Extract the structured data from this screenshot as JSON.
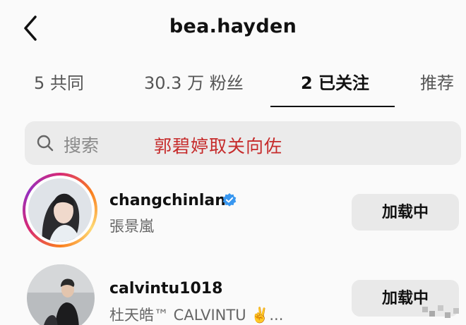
{
  "header": {
    "title": "bea.hayden",
    "back_icon": "chevron-left-icon"
  },
  "tabs": [
    {
      "label": "5 共同",
      "active": false
    },
    {
      "label": "30.3 万 粉丝",
      "active": false
    },
    {
      "label": "2 已关注",
      "active": true
    },
    {
      "label": "推荐",
      "active": false
    }
  ],
  "search": {
    "placeholder": "搜索",
    "overlay_caption": "郭碧婷取关向佐",
    "icon": "search-icon"
  },
  "list": [
    {
      "username": "changchinlan",
      "verified": true,
      "full_name": "張景嵐",
      "button_label": "加载中",
      "has_story_ring": true
    },
    {
      "username": "calvintu1018",
      "verified": false,
      "full_name": "杜天皓™ CALVINTU ✌️...",
      "button_label": "加载中",
      "has_story_ring": false
    }
  ],
  "colors": {
    "background": "#fafafa",
    "overlay_text": "#c62b2b",
    "verified": "#3897f0",
    "button_bg": "#e9e9e9"
  }
}
